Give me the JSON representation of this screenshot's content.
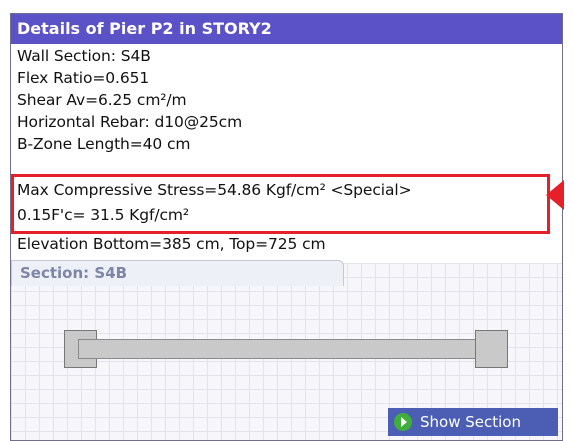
{
  "panel": {
    "title": "Details of Pier P2 in STORY2"
  },
  "details": {
    "wall_section": "Wall Section: S4B",
    "flex_ratio": "Flex Ratio=0.651",
    "shear_av": "Shear Av=6.25 cm²/m",
    "horizontal_rebar": "Horizontal Rebar: d10@25cm",
    "bzone_length": "B-Zone Length=40 cm",
    "max_compressive_stress": "Max Compressive Stress=54.86 Kgf/cm²  <Special>",
    "fc_limit": "0.15F'c= 31.5 Kgf/cm²",
    "elevation": "Elevation Bottom=385 cm,   Top=725 cm"
  },
  "section": {
    "tab_label": "Section: S4B"
  },
  "buttons": {
    "show_section": "Show Section"
  },
  "colors": {
    "title_bar": "#5b52c8",
    "highlight": "#e5202a",
    "button": "#4c5eb3"
  }
}
